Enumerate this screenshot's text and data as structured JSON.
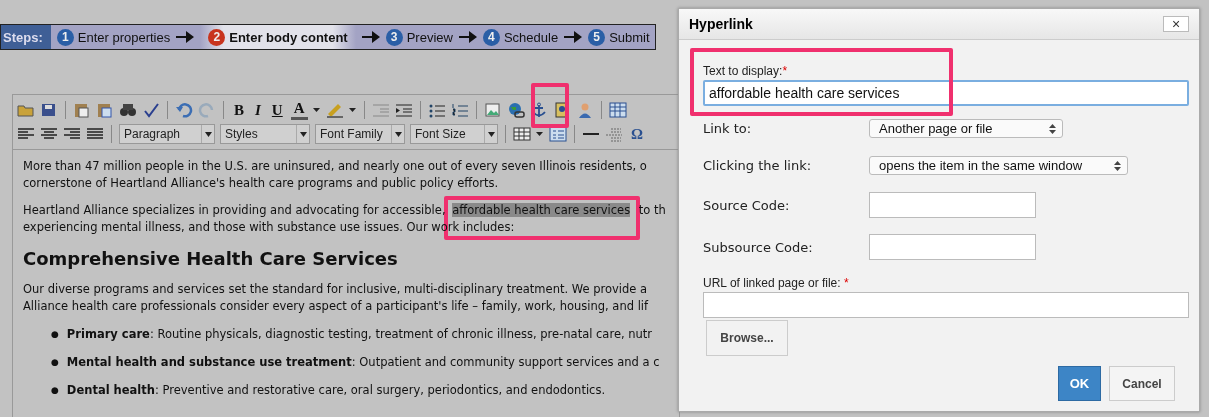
{
  "steps": {
    "title": "Steps:",
    "items": [
      {
        "number": "1",
        "label": "Enter properties",
        "selected": false
      },
      {
        "number": "2",
        "label": "Enter body content",
        "selected": true
      },
      {
        "number": "3",
        "label": "Preview",
        "selected": false
      },
      {
        "number": "4",
        "label": "Schedule",
        "selected": false
      },
      {
        "number": "5",
        "label": "Submit",
        "selected": false
      }
    ]
  },
  "toolbar": {
    "format_buttons": [
      "B",
      "I",
      "U"
    ],
    "font_color": "A",
    "special_char": "Ω",
    "selects": [
      "Paragraph",
      "Styles",
      "Font Family",
      "Font Size"
    ]
  },
  "editor": {
    "paragraphs": [
      {
        "lines": [
          "More than 47 million people in the U.S. are uninsured, and nearly one out of every seven Illinois residents, o",
          "cornerstone of Heartland Alliance's health care programs and public policy efforts."
        ]
      },
      {
        "before": "Heartland Alliance specializes in providing and advocating for accessible, ",
        "selected_text": "affordable health care services",
        "after": " to th",
        "lines": [
          "experiencing mental illness, and those with substance use issues.  Our work includes:"
        ]
      }
    ],
    "heading": "Comprehensive Health Care Services",
    "paragraph": [
      "Our diverse programs and services set the standard for inclusive, multi-disciplinary treatment.  We provide a",
      "Alliance health care professionals consider every aspect of a participant's life – family, work, housing, and lif"
    ],
    "bullets": [
      {
        "marker": "●",
        "text": "**Primary care**: Routine physicals, diagnostic testing, treatment of chronic illness, pre-natal care, nutr"
      },
      {
        "marker": "●",
        "text": "**Mental health and substance use treatment**: Outpatient and community support services and a c"
      },
      {
        "marker": "●",
        "text": "**Dental health**: Preventive and restorative care, oral surgery, periodontics, and endodontics."
      }
    ]
  },
  "dialog": {
    "title": "Hyperlink",
    "close": "×",
    "text_to_display": {
      "label": "Text to display:",
      "required": "*",
      "value": "affordable health care services"
    },
    "link_to": {
      "label": "Link to:",
      "value": "Another page or file"
    },
    "clicking": {
      "label": "Clicking the link:",
      "value": "opens the item in the same window"
    },
    "source_code": {
      "label": "Source Code:"
    },
    "subsource_code": {
      "label": "Subsource Code:"
    },
    "url": {
      "label": "URL of linked page or file: ",
      "required": "*"
    },
    "browse": "Browse...",
    "ok": "OK",
    "cancel": "Cancel"
  }
}
